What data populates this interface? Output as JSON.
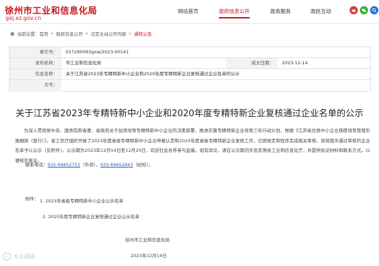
{
  "header": {
    "site_title": "徐州市工业和信息化局",
    "site_url": "gxj.xz.gov.cn",
    "nav": [
      {
        "label": "网站首页"
      },
      {
        "label": "政府信息公开"
      },
      {
        "label": "政务服务"
      },
      {
        "label": "政民互动"
      }
    ],
    "icons": [
      {
        "name": "weibo-icon",
        "color": "#d43f3a"
      },
      {
        "name": "wechat-icon",
        "color": "#3cb034"
      },
      {
        "name": "search-icon",
        "color": "#2a6fd1"
      }
    ]
  },
  "breadcrumb": {
    "prefix": "当前位置：",
    "items": [
      "首页",
      "政府信息公开",
      "法定主动公开内容",
      "通知公告"
    ]
  },
  "info": {
    "index_label": "索引号：",
    "index_value": "017290093gxw/2023-00141",
    "publisher_label": "发布机构：",
    "publisher_value": "市工业和信息化局",
    "date_label": "成文日期：",
    "date_value": "2023-12-14",
    "title_label": "信息名称：",
    "title_value": "关于江苏省2023年专精特新中小企业和2020年度专精特新企业复核通过企业名单的公示",
    "docno_label": "文号：",
    "docno_value": ""
  },
  "article": {
    "title": "关于江苏省2023年专精特新中小企业和2020年度专精特新企业复核通过企业名单的公示",
    "body": "为深入贯彻党中央、国务院和省委、省政府关于加快培育专精特新中小企业的决策部署，推进实施专精特新企业培育三年行动计划，根据《江苏省优质中小企业梯度培育管理实施细则（暂行）》，省工信厅组织开展了2023年度省级专精特新中小企业申报认定和2020年度省级专精特新企业复核工作，已按规定和程序完成相关审核，现将我市通过审核的企业名单予以公示（见附件）。公示期为2023年12月14日至12月20日，欢迎社会各界参与监督。如有异议，请在公示期内实名反馈省工业和信息化厅，并提供佐证材料和联系方式，以便核实查证。",
    "contact_prefix": "联系电话：",
    "phone1": "025-69652751",
    "contact_mid": "（外资），",
    "phone2": "025-69652843",
    "contact_suffix": "（纪检）。",
    "attachments_label": "附件：",
    "attachment1": "1. 2023年省级专精特新中小企业公示名单",
    "attachment2": "2. 2020年度专精特新企业复核通过企业公示名单",
    "signature_org": "徐州市工业和信息化局",
    "signature_date": "2023年12月14日"
  },
  "watermark": {
    "text": "大众调研"
  }
}
